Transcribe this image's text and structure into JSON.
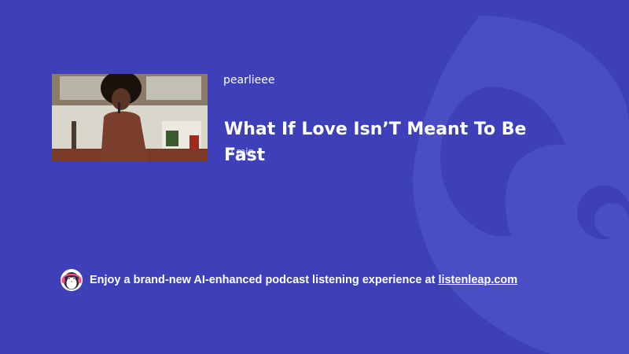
{
  "episode": {
    "author": "pearlieee",
    "title": "What If Love Isn’T Meant To Be Fast",
    "duration": "0 min"
  },
  "promo": {
    "text": "Enjoy a brand-new AI-enhanced podcast listening experience at",
    "link_text": "listenleap.com",
    "mascot_icon": "penguin-headphones-icon"
  },
  "colors": {
    "background": "#3d40b8",
    "watermark": "#4a4ec4",
    "text": "#ffffff"
  }
}
